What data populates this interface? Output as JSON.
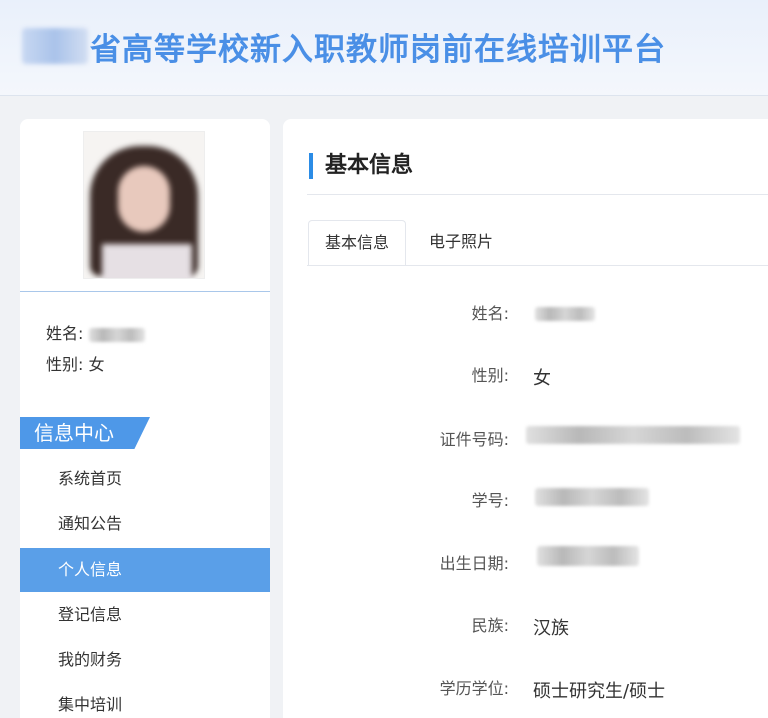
{
  "header": {
    "title": "省高等学校新入职教师岗前在线培训平台"
  },
  "profile": {
    "name_label": "姓名:",
    "gender_label": "性别:",
    "gender_value": "女"
  },
  "menu": {
    "heading": "信息中心",
    "items": [
      {
        "label": "系统首页"
      },
      {
        "label": "通知公告"
      },
      {
        "label": "个人信息",
        "active": true
      },
      {
        "label": "登记信息"
      },
      {
        "label": "我的财务"
      },
      {
        "label": "集中培训"
      }
    ]
  },
  "main": {
    "section_title": "基本信息",
    "tabs": [
      {
        "label": "基本信息",
        "active": true
      },
      {
        "label": "电子照片"
      }
    ],
    "fields": [
      {
        "label": "姓名:",
        "value": ""
      },
      {
        "label": "性别:",
        "value": "女"
      },
      {
        "label": "证件号码:",
        "value": ""
      },
      {
        "label": "学号:",
        "value": ""
      },
      {
        "label": "出生日期:",
        "value": ""
      },
      {
        "label": "民族:",
        "value": "汉族"
      },
      {
        "label": "学历学位:",
        "value": "硕士研究生/硕士"
      }
    ]
  },
  "colors": {
    "accent": "#4a8fe6",
    "menu_active": "#5a9fe8",
    "section_bar": "#2b8ce6"
  }
}
